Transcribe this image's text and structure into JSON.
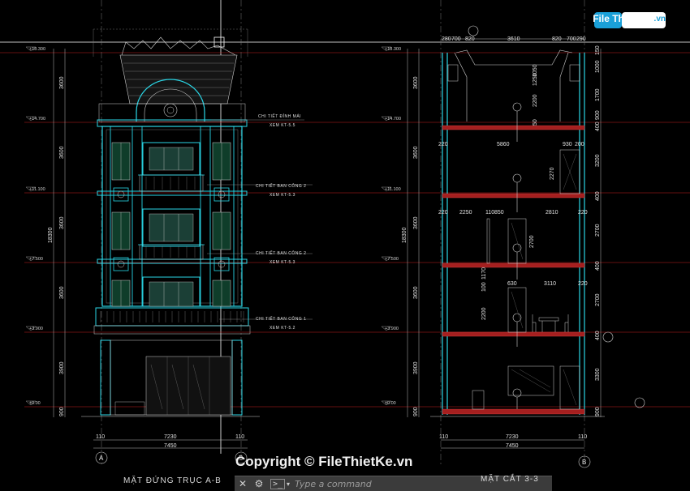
{
  "watermark": {
    "brand": "File Thiết Kế",
    "domain": ".vn",
    "copyright": "Copyright © FileThietKe.vn"
  },
  "elevation": {
    "title": "MẶT ĐỨNG TRỤC A-B",
    "levels": [
      "+18.300",
      "+14.700",
      "+11.100",
      "+7.500",
      "+3.900",
      "±0.00"
    ],
    "heights": [
      "3600",
      "3600",
      "3600",
      "3600",
      "3600",
      "3900",
      "900"
    ],
    "total_height": "18300",
    "width_dims": [
      "110",
      "7230",
      "110"
    ],
    "total_width": "7450",
    "grid_left": "A",
    "grid_right": "B",
    "callouts": [
      {
        "title": "CHI TIẾT ĐỈNH MÁI",
        "ref": "XEM KT-5.5"
      },
      {
        "title": "CHI TIẾT BAN CÔNG 2",
        "ref": "XEM KT-5.3"
      },
      {
        "title": "CHI TIẾT BAN CÔNG 2",
        "ref": "XEM KT-5.3"
      },
      {
        "title": "CHI TIẾT BAN CÔNG 1",
        "ref": "XEM KT-5.2"
      }
    ]
  },
  "section": {
    "title": "MẶT CẮT 3-3",
    "top_dims": [
      "280",
      "700",
      "820",
      "3610",
      "820",
      "700",
      "290"
    ],
    "level_dims": [
      "150",
      "1000",
      "1700",
      "900",
      "400",
      "3200",
      "400",
      "2700",
      "400",
      "2700",
      "400",
      "3300",
      "900"
    ],
    "interior_dims": [
      "220",
      "5860",
      "930",
      "200",
      "220",
      "2250",
      "110",
      "850",
      "2810",
      "220",
      "630",
      "3110",
      "220",
      "100",
      "1170",
      "2200",
      "2270",
      "2700",
      "1050",
      "1250",
      "2200",
      "50"
    ],
    "bottom_dims": [
      "110",
      "7230",
      "110"
    ],
    "total_width": "7450",
    "grid_right": "B"
  },
  "cad": {
    "command_placeholder": "Type a command",
    "close_label": "✕",
    "settings_label": "⚙",
    "prompt_label": ">_"
  }
}
